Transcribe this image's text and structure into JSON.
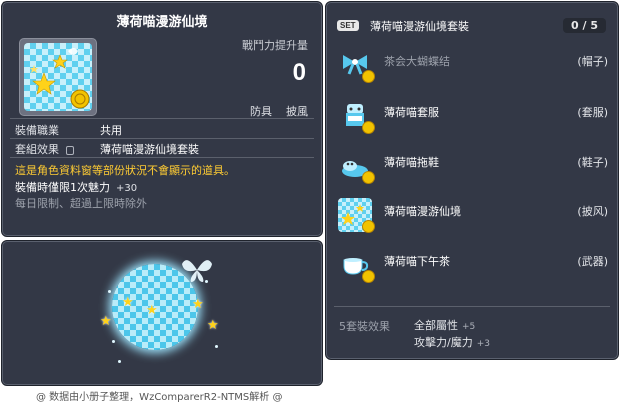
{
  "image_id_label": "01102836",
  "tooltip": {
    "title": "薄荷喵漫游仙境",
    "combat_label": "戰鬥力提升量",
    "combat_value": "0",
    "buttons": [
      "防具",
      "披風"
    ],
    "job_label": "裝備職業",
    "job_value": "共用",
    "set_label": "套組效果",
    "set_value": "薄荷喵漫游仙境套裝",
    "warning": "這是角色資料窗等部份狀況不會顯示的道具。",
    "charm_text": "裝備時僅限1次魅力",
    "charm_value": "+30",
    "limit_text": "每日限制、超過上限時除外"
  },
  "set_panel": {
    "badge": "SET",
    "name": "薄荷喵漫游仙境套裝",
    "count": "0 / 5",
    "items": [
      {
        "name": "茶会大蝴蝶结",
        "slot": "(帽子)",
        "icon": "bow-icon"
      },
      {
        "name": "薄荷喵套服",
        "slot": "(套服)",
        "icon": "outfit-icon"
      },
      {
        "name": "薄荷喵拖鞋",
        "slot": "(鞋子)",
        "icon": "slipper-icon"
      },
      {
        "name": "薄荷喵漫游仙境",
        "slot": "(披风)",
        "icon": "cape-icon"
      },
      {
        "name": "薄荷喵下午茶",
        "slot": "(武器)",
        "icon": "teacup-icon"
      }
    ],
    "effect_label": "5套裝效果",
    "effects": [
      {
        "text": "全部屬性",
        "value": "+5"
      },
      {
        "text": "攻擊力/魔力",
        "value": "+3"
      }
    ]
  },
  "credit": "@ 数据由小册子整理，WzComparerR2-NTMS解析 @",
  "colors": {
    "panel": "#333846",
    "warning": "#ffcc33",
    "accent_cyan": "#5fd0ef"
  }
}
